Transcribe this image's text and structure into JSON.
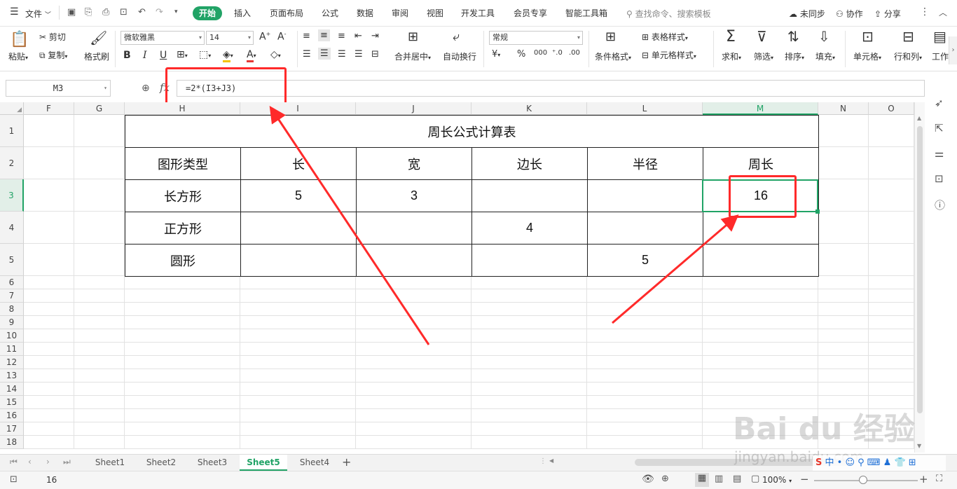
{
  "menubar": {
    "file_label": "文件",
    "tabs": [
      "开始",
      "插入",
      "页面布局",
      "公式",
      "数据",
      "审阅",
      "视图",
      "开发工具",
      "会员专享",
      "智能工具箱"
    ],
    "active_tab": "开始",
    "search_placeholder": "查找命令、搜索模板",
    "sync_label": "未同步",
    "collab_label": "协作",
    "share_label": "分享"
  },
  "ribbon": {
    "paste": "粘贴",
    "cut": "剪切",
    "copy": "复制",
    "format_painter": "格式刷",
    "font_name": "微软雅黑",
    "font_size": "14",
    "merge_center": "合并居中",
    "wrap_text": "自动换行",
    "number_format": "常规",
    "cond_format": "条件格式",
    "table_style": "表格样式",
    "cell_style": "单元格样式",
    "sum": "求和",
    "filter": "筛选",
    "sort": "排序",
    "fill": "填充",
    "cell": "单元格",
    "row_col": "行和列",
    "worksheet": "工作"
  },
  "formula_bar": {
    "name_box": "M3",
    "fx": "fx",
    "formula": "=2*(I3+J3)"
  },
  "grid": {
    "columns": [
      "F",
      "G",
      "H",
      "I",
      "J",
      "K",
      "L",
      "M",
      "N",
      "O"
    ],
    "rows": [
      "1",
      "2",
      "3",
      "4",
      "5",
      "6",
      "7",
      "8",
      "9",
      "10",
      "11",
      "12",
      "13",
      "14",
      "15",
      "16",
      "17",
      "18"
    ],
    "selected_column": "M",
    "selected_row": "3"
  },
  "table": {
    "title": "周长公式计算表",
    "headers": [
      "图形类型",
      "长",
      "宽",
      "边长",
      "半径",
      "周长"
    ],
    "rows": [
      [
        "长方形",
        "5",
        "3",
        "",
        "",
        "16"
      ],
      [
        "正方形",
        "",
        "",
        "4",
        "",
        ""
      ],
      [
        "圆形",
        "",
        "",
        "",
        "5",
        ""
      ]
    ]
  },
  "sheets": {
    "tabs": [
      "Sheet1",
      "Sheet2",
      "Sheet3",
      "Sheet5",
      "Sheet4"
    ],
    "active": "Sheet5",
    "add": "+"
  },
  "status": {
    "value": "16",
    "zoom": "100%"
  },
  "watermark": {
    "line1": "Bai du 经验",
    "line2": "jingyan.baidu.com"
  },
  "colors": {
    "accent": "#21a366",
    "annotation": "#ff2a2a"
  }
}
